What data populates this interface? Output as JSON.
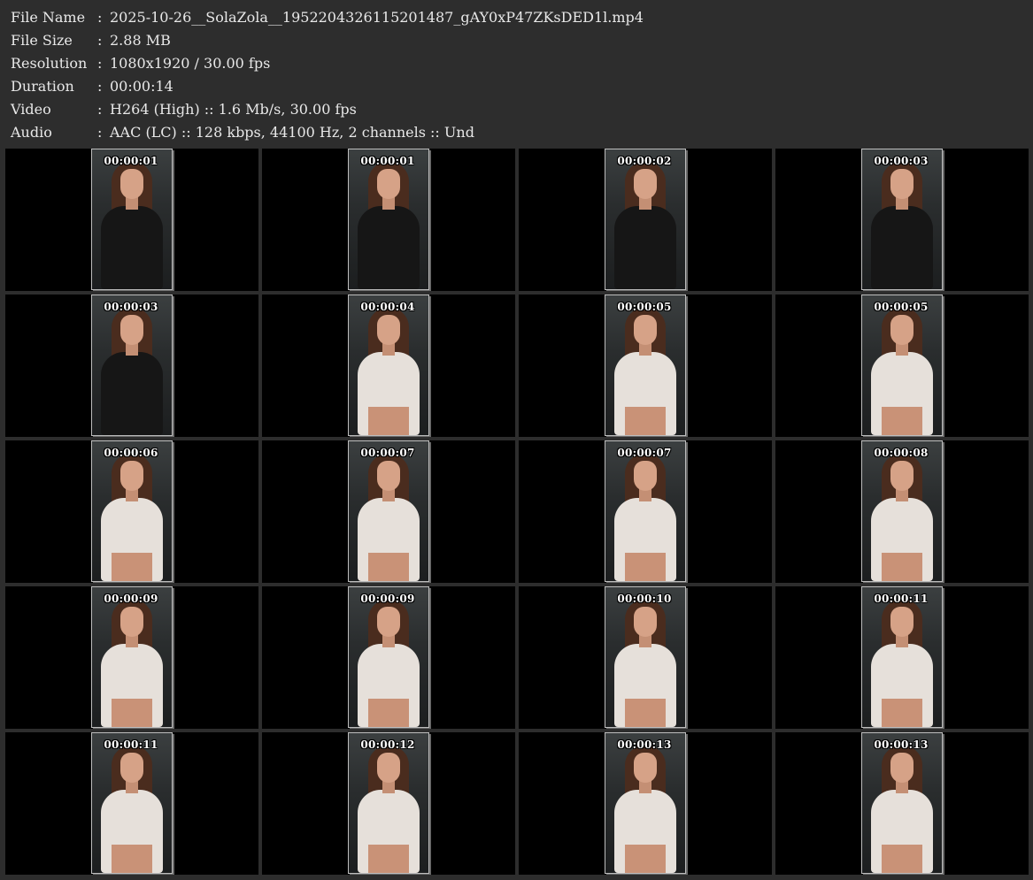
{
  "info": [
    {
      "label": "File Name",
      "value": "2025-10-26__SolaZola__1952204326115201487_gAY0xP47ZKsDED1l.mp4"
    },
    {
      "label": "File Size",
      "value": "2.88 MB"
    },
    {
      "label": "Resolution",
      "value": "1080x1920 / 30.00 fps"
    },
    {
      "label": "Duration",
      "value": "00:00:14"
    },
    {
      "label": "Video",
      "value": "H264 (High) :: 1.6 Mb/s, 30.00 fps"
    },
    {
      "label": "Audio",
      "value": "AAC (LC) :: 128 kbps, 44100 Hz, 2 channels :: Und"
    }
  ],
  "colon": ":",
  "thumbnails": [
    {
      "time": "00:00:01",
      "outfit": "dark"
    },
    {
      "time": "00:00:01",
      "outfit": "dark"
    },
    {
      "time": "00:00:02",
      "outfit": "dark"
    },
    {
      "time": "00:00:03",
      "outfit": "dark"
    },
    {
      "time": "00:00:03",
      "outfit": "dark"
    },
    {
      "time": "00:00:04",
      "outfit": "light"
    },
    {
      "time": "00:00:05",
      "outfit": "light"
    },
    {
      "time": "00:00:05",
      "outfit": "light"
    },
    {
      "time": "00:00:06",
      "outfit": "light"
    },
    {
      "time": "00:00:07",
      "outfit": "light"
    },
    {
      "time": "00:00:07",
      "outfit": "light"
    },
    {
      "time": "00:00:08",
      "outfit": "light"
    },
    {
      "time": "00:00:09",
      "outfit": "light"
    },
    {
      "time": "00:00:09",
      "outfit": "light"
    },
    {
      "time": "00:00:10",
      "outfit": "light"
    },
    {
      "time": "00:00:11",
      "outfit": "light"
    },
    {
      "time": "00:00:11",
      "outfit": "light"
    },
    {
      "time": "00:00:12",
      "outfit": "light"
    },
    {
      "time": "00:00:13",
      "outfit": "light"
    },
    {
      "time": "00:00:13",
      "outfit": "light"
    }
  ]
}
